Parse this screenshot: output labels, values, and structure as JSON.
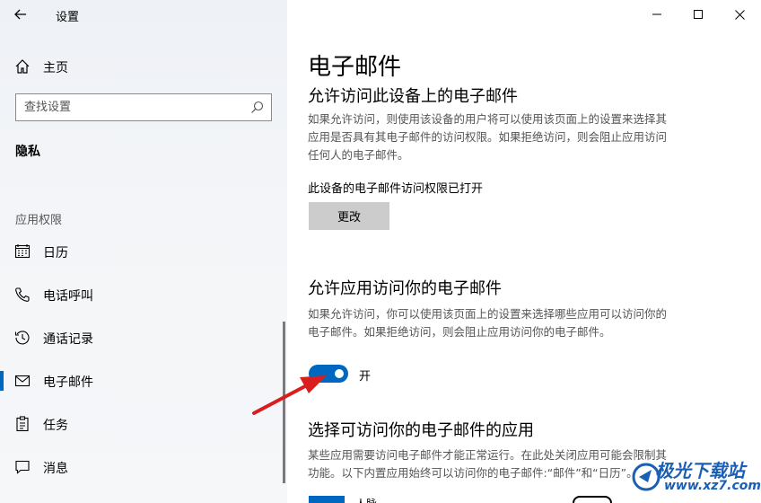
{
  "window": {
    "title": "设置",
    "controls": [
      "minimize",
      "maximize",
      "close"
    ]
  },
  "sidebar": {
    "home_label": "主页",
    "search_placeholder": "查找设置",
    "section_title": "隐私",
    "group_title": "应用权限",
    "items": [
      {
        "label": "日历",
        "icon": "calendar-icon"
      },
      {
        "label": "电话呼叫",
        "icon": "phone-icon"
      },
      {
        "label": "通话记录",
        "icon": "history-icon"
      },
      {
        "label": "电子邮件",
        "icon": "mail-icon",
        "active": true
      },
      {
        "label": "任务",
        "icon": "clipboard-icon"
      },
      {
        "label": "消息",
        "icon": "message-icon"
      }
    ]
  },
  "main": {
    "title": "电子邮件",
    "section1": {
      "heading": "允许访问此设备上的电子邮件",
      "line1": "如果允许访问，则使用该设备的用户将可以使用该页面上的设置来选择其",
      "line2": "应用是否具有其电子邮件的访问权限。如果拒绝访问，则会阻止应用访问",
      "line3": "任何人的电子邮件。",
      "status": "此设备的电子邮件访问权限已打开",
      "change_button": "更改"
    },
    "section2": {
      "heading": "允许应用访问你的电子邮件",
      "line1": "如果允许访问，你可以使用该页面上的设置来选择哪些应用可以访问你的",
      "line2": "电子邮件。如果拒绝访问，则会阻止应用访问你的电子邮件。",
      "toggle_state": "on",
      "toggle_label": "开"
    },
    "section3": {
      "heading": "选择可访问你的电子邮件的应用",
      "line1": "某些应用需要访问电子邮件才能正常运行。在此处关闭应用可能会限制其",
      "line2": "功能。以下内置应用始终可以访问你的电子邮件:“邮件”和“日历”。",
      "app_name_partial": "人脉"
    }
  },
  "watermark": {
    "name": "极光下载站",
    "url": "www.xz7.com"
  },
  "colors": {
    "accent": "#0067c0",
    "arrow": "#e02020",
    "sidebar_bg": "#f3f5f8"
  }
}
